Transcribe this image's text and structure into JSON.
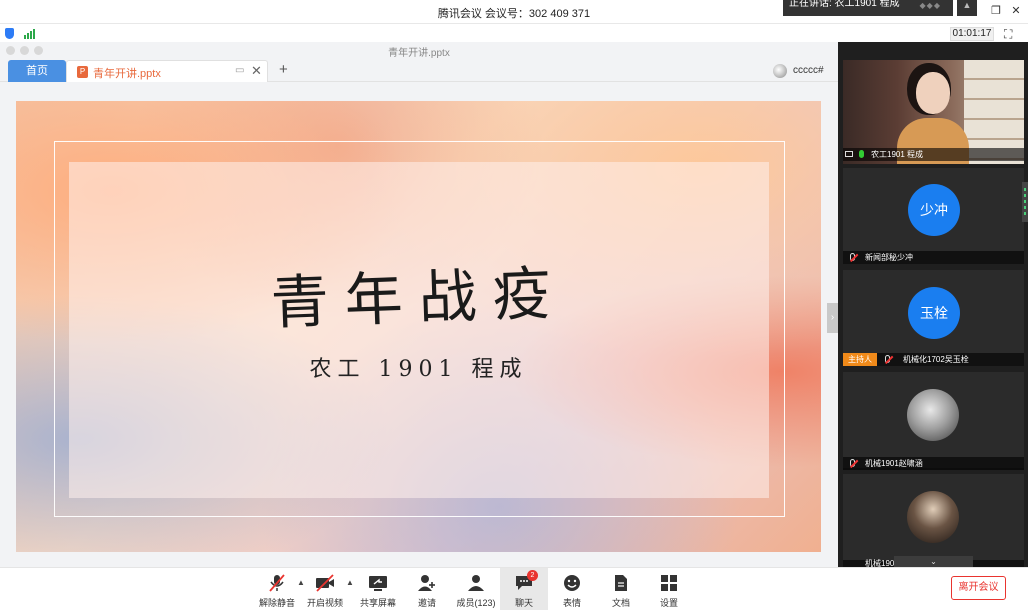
{
  "window": {
    "title": "腾讯会议 会议号：302 409 371",
    "speaking_label": "正在讲话: 农工1901 程成",
    "timer": "01:01:17"
  },
  "document": {
    "file_title": "青年开讲.pptx",
    "tabs": [
      {
        "label": "首页",
        "active": true
      },
      {
        "label": "青年开讲.pptx",
        "active": false
      }
    ],
    "collaborator": "ccccc#"
  },
  "slide": {
    "headline": "青年战疫",
    "subtitle": "农工 1901 程成"
  },
  "participants": [
    {
      "name": "农工1901 程成",
      "type": "video",
      "mic": "on"
    },
    {
      "name": "新闻部秘少冲",
      "type": "avatar",
      "avatar_text": "少冲",
      "mic": "muted"
    },
    {
      "name": "机械化1702吴玉栓",
      "type": "avatar",
      "avatar_text": "玉栓",
      "mic": "muted",
      "badge": "主持人"
    },
    {
      "name": "机械1901赵啸涵",
      "type": "photo",
      "mic": "muted"
    },
    {
      "name": "机械1902",
      "type": "photo",
      "mic": "muted"
    }
  ],
  "toolbar": {
    "items": [
      {
        "label": "解除静音",
        "icon": "mic-muted-icon"
      },
      {
        "label": "开启视频",
        "icon": "camera-off-icon"
      },
      {
        "label": "共享屏幕",
        "icon": "share-screen-icon"
      },
      {
        "label": "邀请",
        "icon": "invite-icon"
      },
      {
        "label": "成员(123)",
        "icon": "members-icon"
      },
      {
        "label": "聊天",
        "icon": "chat-icon",
        "badge": "2"
      },
      {
        "label": "表情",
        "icon": "emoji-icon"
      },
      {
        "label": "文档",
        "icon": "document-icon"
      },
      {
        "label": "设置",
        "icon": "settings-icon"
      }
    ],
    "leave_label": "离开会议"
  },
  "colors": {
    "accent": "#4a90e2",
    "avatar_blue": "#1a7ef0",
    "danger": "#e9342f",
    "host_badge": "#f08a1a",
    "ppt_orange": "#e8693c"
  }
}
